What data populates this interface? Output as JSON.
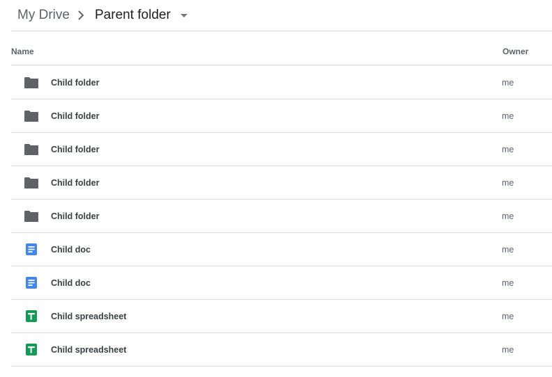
{
  "breadcrumb": {
    "root_label": "My Drive",
    "separator_icon": "chevron-right-icon",
    "current_label": "Parent folder",
    "dropdown_icon": "caret-down-icon"
  },
  "list_header": {
    "name_label": "Name",
    "owner_label": "Owner"
  },
  "colors": {
    "folder": "#5f6368",
    "doc": "#4285f4",
    "sheet": "#0f9d58",
    "divider": "#dadce0"
  },
  "files": [
    {
      "name": "Child folder",
      "owner": "me",
      "type": "folder",
      "icon": "folder-icon"
    },
    {
      "name": "Child folder",
      "owner": "me",
      "type": "folder",
      "icon": "folder-icon"
    },
    {
      "name": "Child folder",
      "owner": "me",
      "type": "folder",
      "icon": "folder-icon"
    },
    {
      "name": "Child folder",
      "owner": "me",
      "type": "folder",
      "icon": "folder-icon"
    },
    {
      "name": "Child folder",
      "owner": "me",
      "type": "folder",
      "icon": "folder-icon"
    },
    {
      "name": "Child doc",
      "owner": "me",
      "type": "doc",
      "icon": "google-docs-icon"
    },
    {
      "name": "Child doc",
      "owner": "me",
      "type": "doc",
      "icon": "google-docs-icon"
    },
    {
      "name": "Child spreadsheet",
      "owner": "me",
      "type": "sheet",
      "icon": "google-sheets-icon"
    },
    {
      "name": "Child spreadsheet",
      "owner": "me",
      "type": "sheet",
      "icon": "google-sheets-icon"
    }
  ]
}
